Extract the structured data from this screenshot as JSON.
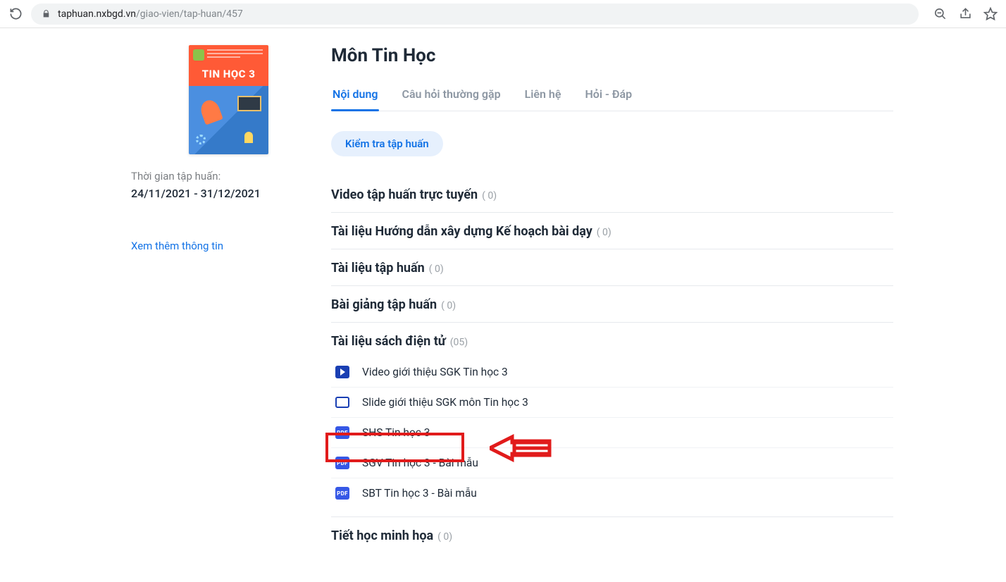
{
  "browser": {
    "url_host": "taphuan.nxbgd.vn",
    "url_path": "/giao-vien/tap-huan/457"
  },
  "sidebar": {
    "cover_title": "TIN HỌC 3",
    "period_label": "Thời gian tập huấn:",
    "period_value": "24/11/2021 - 31/12/2021",
    "more_info_label": "Xem thêm thông tin"
  },
  "main": {
    "page_title": "Môn Tin Học",
    "tabs": [
      {
        "label": "Nội dung"
      },
      {
        "label": "Câu hỏi thường gặp"
      },
      {
        "label": "Liên hệ"
      },
      {
        "label": "Hỏi - Đáp"
      }
    ],
    "test_button_label": "Kiểm tra tập huấn",
    "sections": [
      {
        "title": "Video tập huấn trực tuyến",
        "count_label": "( 0)"
      },
      {
        "title": "Tài liệu Hướng dẫn xây dựng Kế hoạch bài dạy",
        "count_label": "( 0)"
      },
      {
        "title": "Tài liệu tập huấn",
        "count_label": "( 0)"
      },
      {
        "title": "Bài giảng tập huấn",
        "count_label": "( 0)"
      },
      {
        "title": "Tài liệu sách điện tử",
        "count_label": "(05)",
        "items": [
          {
            "icon": "play",
            "label": "Video giới thiệu SGK Tin học 3"
          },
          {
            "icon": "slide",
            "label": "Slide giới thiệu SGK môn Tin học 3"
          },
          {
            "icon": "pdf",
            "label": "SHS Tin học 3"
          },
          {
            "icon": "pdf",
            "label": "SGV Tin học 3 - Bài mẫu"
          },
          {
            "icon": "pdf",
            "label": "SBT Tin học 3 - Bài mẫu"
          }
        ]
      },
      {
        "title": "Tiết học minh họa",
        "count_label": "( 0)"
      }
    ],
    "pdf_badge": "PDF"
  }
}
